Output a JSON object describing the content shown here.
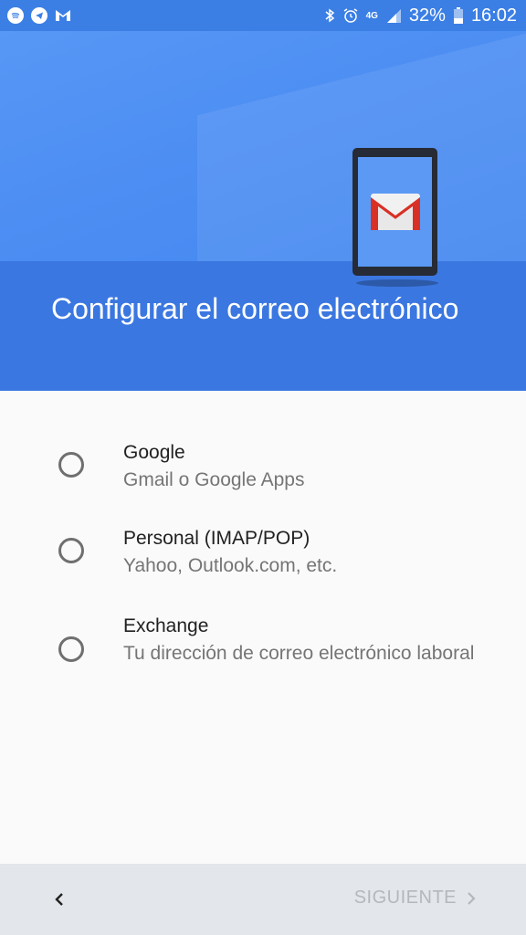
{
  "status_bar": {
    "battery": "32%",
    "time": "16:02",
    "network": "4G",
    "left_icons": [
      "spotify-icon",
      "telegram-icon",
      "airmail-icon"
    ],
    "right_icons": [
      "bluetooth-icon",
      "alarm-icon",
      "signal-icon",
      "battery-icon"
    ]
  },
  "header": {
    "title": "Configurar el correo electrónico",
    "illustration_icon": "gmail-logo-icon"
  },
  "options": [
    {
      "title": "Google",
      "subtitle": "Gmail o Google Apps",
      "selected": false
    },
    {
      "title": "Personal (IMAP/POP)",
      "subtitle": "Yahoo, Outlook.com, etc.",
      "selected": false
    },
    {
      "title": "Exchange",
      "subtitle": "Tu dirección de correo electrónico laboral",
      "selected": false
    }
  ],
  "bottom_bar": {
    "next_label": "SIGUIENTE",
    "back_icon": "chevron-left-icon",
    "next_icon": "chevron-right-icon"
  },
  "colors": {
    "header_blue": "#4a8af0",
    "header_band": "#3b77e0",
    "gmail_red": "#d93025",
    "disabled_text": "#b4b7bc"
  }
}
